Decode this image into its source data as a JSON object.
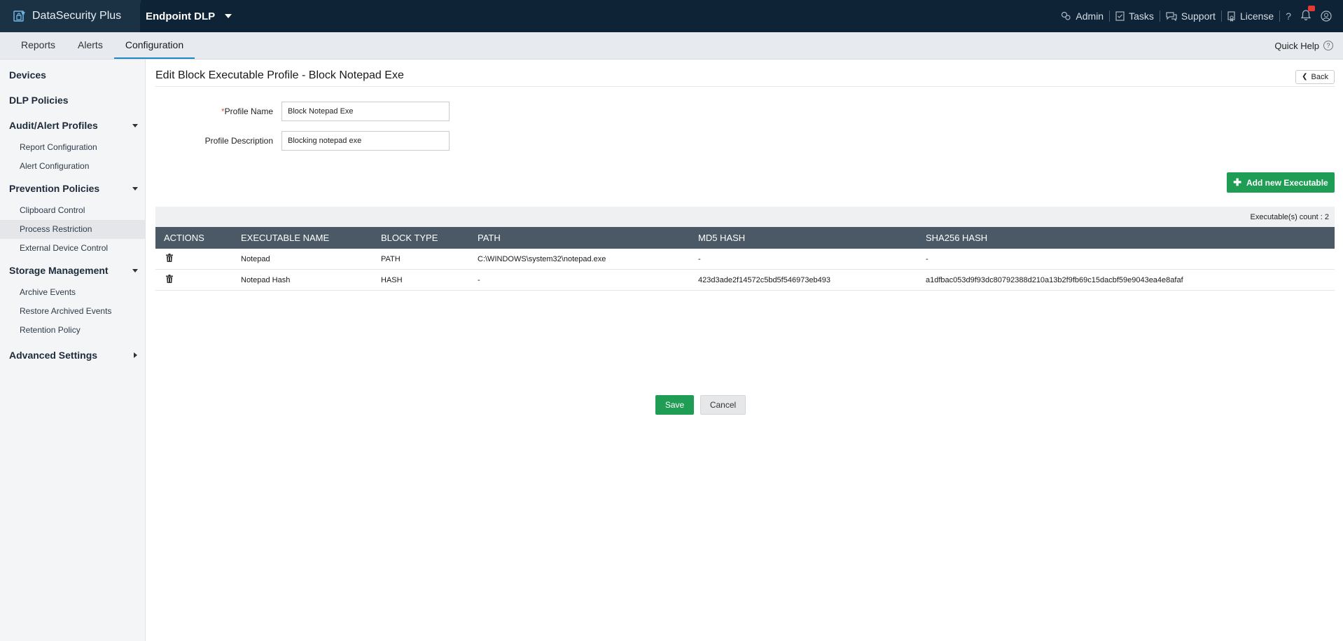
{
  "header": {
    "brand": "DataSecurity Plus",
    "product": "Endpoint DLP",
    "items": [
      {
        "label": "Admin",
        "icon": "admin-icon"
      },
      {
        "label": "Tasks",
        "icon": "tasks-icon"
      },
      {
        "label": "Support",
        "icon": "support-icon"
      },
      {
        "label": "License",
        "icon": "license-icon"
      }
    ],
    "help_glyph": "?",
    "colors": {
      "bar": "#0e2336",
      "accent": "#1f9d55",
      "badge": "#e53935"
    }
  },
  "tabs": [
    "Reports",
    "Alerts",
    "Configuration"
  ],
  "active_tab": "Configuration",
  "quick_help": "Quick Help",
  "sidebar": {
    "devices": "Devices",
    "dlp_policies": "DLP Policies",
    "audit": {
      "label": "Audit/Alert Profiles",
      "items": [
        "Report Configuration",
        "Alert Configuration"
      ]
    },
    "prevention": {
      "label": "Prevention Policies",
      "items": [
        "Clipboard Control",
        "Process Restriction",
        "External Device Control"
      ]
    },
    "storage": {
      "label": "Storage Management",
      "items": [
        "Archive Events",
        "Restore Archived Events",
        "Retention Policy"
      ]
    },
    "advanced": "Advanced Settings"
  },
  "main": {
    "title": "Edit Block Executable Profile - Block Notepad Exe",
    "back": "Back",
    "required_mark": "*",
    "profile_name_label": "Profile Name",
    "profile_name_value": "Block Notepad Exe",
    "profile_desc_label": "Profile Description",
    "profile_desc_value": "Blocking notepad exe",
    "add_button": "Add new Executable",
    "count_text": "Executable(s) count : 2",
    "columns": [
      "ACTIONS",
      "EXECUTABLE NAME",
      "BLOCK TYPE",
      "PATH",
      "MD5 HASH",
      "SHA256 HASH"
    ],
    "rows": [
      {
        "name": "Notepad",
        "type": "PATH",
        "path": "C:\\WINDOWS\\system32\\notepad.exe",
        "md5": "-",
        "sha256": "-"
      },
      {
        "name": "Notepad Hash",
        "type": "HASH",
        "path": "-",
        "md5": "423d3ade2f14572c5bd5f546973eb493",
        "sha256": "a1dfbac053d9f93dc80792388d210a13b2f9fb69c15dacbf59e9043ea4e8afaf"
      }
    ],
    "save": "Save",
    "cancel": "Cancel"
  }
}
